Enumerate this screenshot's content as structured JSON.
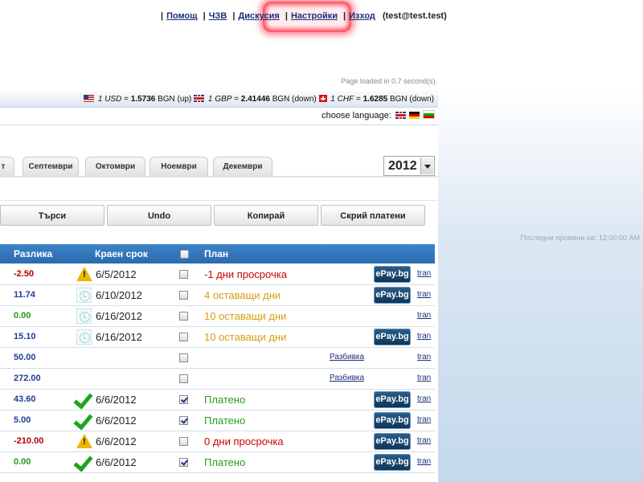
{
  "topnav": {
    "items": [
      "Помощ",
      "ЧЗВ",
      "Дискусия",
      "Настройки",
      "Изход"
    ],
    "user": "(test@test.test)"
  },
  "page_loaded": "Page loaded in 0.7 second(s).",
  "currency": {
    "usd": {
      "label": "1 USD",
      "eq": "=",
      "value": "1.5736",
      "rest": "BGN (up)"
    },
    "gbp": {
      "label": "1 GBP",
      "eq": "=",
      "value": "2.41446",
      "rest": "BGN (down)"
    },
    "chf": {
      "label": "1 CHF",
      "eq": "=",
      "value": "1.6285",
      "rest": "BGN (down)"
    }
  },
  "language_label": "choose language:",
  "months": [
    "т",
    "Септември",
    "Октомври",
    "Ноември",
    "Декември"
  ],
  "year": "2012",
  "buttons": [
    "Търси",
    "Undo",
    "Копирай",
    "Скрий платени"
  ],
  "last_changes": "Последни промени на: 12:00:00 AM",
  "table": {
    "headers": {
      "diff": "Разлика",
      "due": "Краен срок",
      "plan": "План"
    },
    "rows": [
      {
        "diff": "-2.50",
        "diff_color": "#b40000",
        "icon": "warning-icon",
        "date": "6/5/2012",
        "checked": false,
        "plan": "-1 дни просрочка",
        "plan_color": "#cc0000",
        "epay": "ePay.bg",
        "razbivka": "",
        "tran": "tran"
      },
      {
        "diff": "11.74",
        "diff_color": "#1f3d99",
        "icon": "clock-icon",
        "date": "6/10/2012",
        "checked": false,
        "plan": "4 оставащи дни",
        "plan_color": "#d89d10",
        "epay": "ePay.bg",
        "razbivka": "",
        "tran": "tran"
      },
      {
        "diff": "0.00",
        "diff_color": "#2a9a1a",
        "icon": "clock-icon",
        "date": "6/16/2012",
        "checked": false,
        "plan": "10 оставащи дни",
        "plan_color": "#d89d10",
        "epay": "",
        "razbivka": "",
        "tran": "tran"
      },
      {
        "diff": "15.10",
        "diff_color": "#1f3d99",
        "icon": "clock-icon",
        "date": "6/16/2012",
        "checked": false,
        "plan": "10 оставащи дни",
        "plan_color": "#d89d10",
        "epay": "ePay.bg",
        "razbivka": "",
        "tran": "tran"
      },
      {
        "diff": "50.00",
        "diff_color": "#1f3d99",
        "icon": "",
        "date": "",
        "checked": false,
        "plan": "",
        "plan_color": "#222222",
        "epay": "",
        "razbivka": "Разбивка",
        "tran": "tran"
      },
      {
        "diff": "272.00",
        "diff_color": "#1f3d99",
        "icon": "",
        "date": "",
        "checked": false,
        "plan": "",
        "plan_color": "#222222",
        "epay": "",
        "razbivka": "Разбивка",
        "tran": "tran"
      },
      {
        "diff": "43.60",
        "diff_color": "#1f3d99",
        "icon": "check-icon",
        "date": "6/6/2012",
        "checked": true,
        "plan": "Платено",
        "plan_color": "#2a9a1a",
        "epay": "ePay.bg",
        "razbivka": "",
        "tran": "tran"
      },
      {
        "diff": "5.00",
        "diff_color": "#1f3d99",
        "icon": "check-icon",
        "date": "6/6/2012",
        "checked": true,
        "plan": "Платено",
        "plan_color": "#2a9a1a",
        "epay": "ePay.bg",
        "razbivka": "",
        "tran": "tran"
      },
      {
        "diff": "-210.00",
        "diff_color": "#b40000",
        "icon": "warning-icon",
        "date": "6/6/2012",
        "checked": false,
        "plan": "0 дни просрочка",
        "plan_color": "#cc0000",
        "epay": "ePay.bg",
        "razbivka": "",
        "tran": "tran"
      },
      {
        "diff": "0.00",
        "diff_color": "#2a9a1a",
        "icon": "check-icon",
        "date": "6/6/2012",
        "checked": true,
        "plan": "Платено",
        "plan_color": "#2a9a1a",
        "epay": "ePay.bg",
        "razbivka": "",
        "tran": "tran"
      }
    ]
  }
}
